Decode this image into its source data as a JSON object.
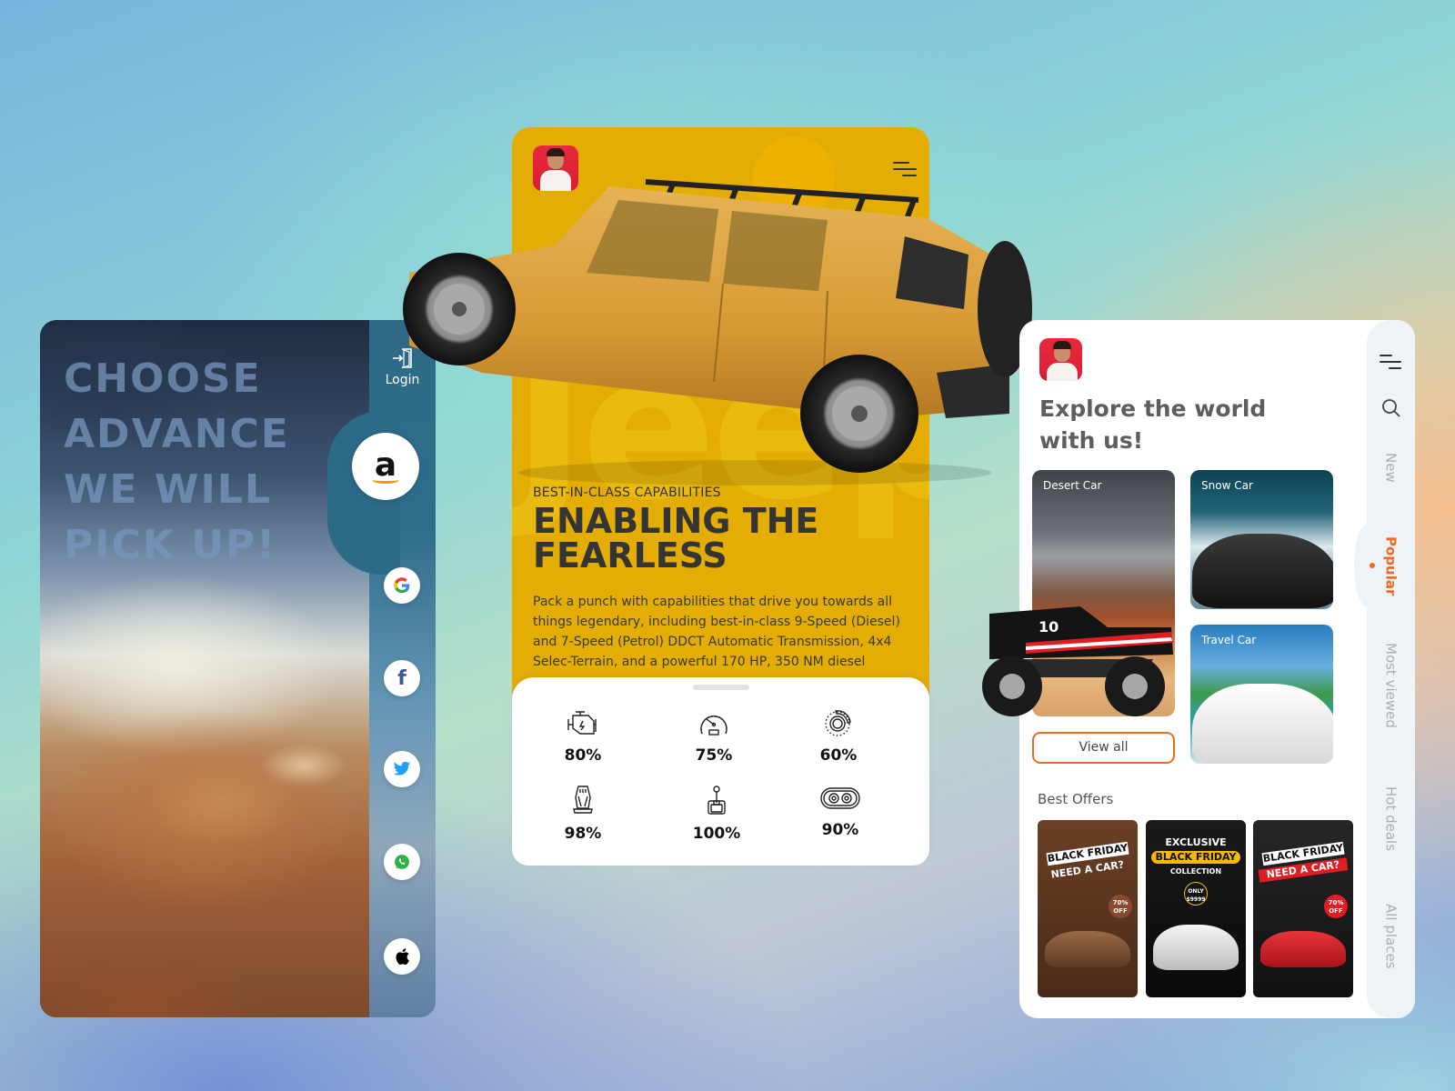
{
  "left_card": {
    "headline_lines": [
      "CHOOSE",
      "ADVANCE",
      "WE WILL",
      "PICK UP!"
    ],
    "login_label": "Login",
    "social_logins": [
      {
        "name": "amazon",
        "glyph": "a",
        "icon": "amazon-icon"
      },
      {
        "name": "google",
        "glyph": "G",
        "icon": "google-icon"
      },
      {
        "name": "facebook",
        "glyph": "f",
        "icon": "facebook-icon"
      },
      {
        "name": "twitter",
        "glyph": "🐦",
        "icon": "twitter-icon"
      },
      {
        "name": "whatsapp",
        "glyph": "✆",
        "icon": "whatsapp-icon"
      },
      {
        "name": "apple",
        "glyph": "",
        "icon": "apple-icon"
      }
    ]
  },
  "middle_card": {
    "background_word": "Jeep",
    "eyebrow": "BEST-IN-CLASS CAPABILITIES",
    "title": "ENABLING THE FEARLESS",
    "body": "Pack a punch with capabilities that drive you towards all things legendary, including best-in-class 9-Speed (Diesel) and 7-Speed (Petrol) DDCT Automatic Transmission, 4x4 Selec-Terrain, and a powerful 170 HP, 350 NM diesel",
    "stats": [
      {
        "icon": "engine-icon",
        "value": "80%"
      },
      {
        "icon": "speedometer-icon",
        "value": "75%"
      },
      {
        "icon": "brake-disc-icon",
        "value": "60%"
      },
      {
        "icon": "car-seat-icon",
        "value": "98%"
      },
      {
        "icon": "gear-shift-icon",
        "value": "100%"
      },
      {
        "icon": "exhaust-icon",
        "value": "90%"
      }
    ]
  },
  "right_card": {
    "title": "Explore the world with us!",
    "categories": [
      {
        "label": "Desert Car"
      },
      {
        "label": "Snow Car"
      },
      {
        "label": "Travel Car"
      }
    ],
    "view_all_label": "View all",
    "best_offers_label": "Best Offers",
    "offers": [
      {
        "line1": "BLACK FRIDAY",
        "line2": "NEED A CAR?",
        "badge": "70% OFF"
      },
      {
        "line1": "EXCLUSIVE",
        "line2": "BLACK FRIDAY",
        "line3": "COLLECTION",
        "badge": "ONLY $9999"
      },
      {
        "line1": "BLACK FRIDAY",
        "line2": "NEED A CAR?",
        "badge": "70% OFF"
      }
    ],
    "side_nav": {
      "tabs": [
        {
          "label": "New",
          "active": false
        },
        {
          "label": "Popular",
          "active": true
        },
        {
          "label": "Most viewed",
          "active": false
        },
        {
          "label": "Hot deals",
          "active": false
        },
        {
          "label": "All places",
          "active": false
        }
      ]
    }
  },
  "colors": {
    "accent_orange": "#ef6a1f",
    "jeep_yellow": "#e3ad04",
    "avatar_red": "#e8283d"
  }
}
